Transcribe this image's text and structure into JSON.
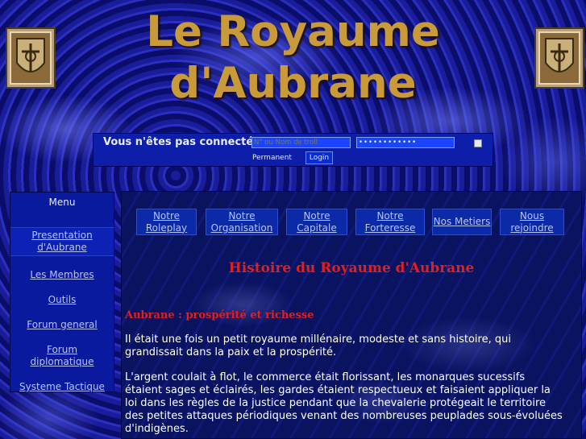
{
  "header": {
    "title_line1": "Le Royaume",
    "title_line2": "d'Aubrane",
    "logo_left": "crest-icon",
    "logo_right": "crest-icon"
  },
  "login": {
    "message": "Vous n'êtes pas connecté :",
    "username_placeholder": "N° ou Nom de troll",
    "password_value": "••••••••••••",
    "permanent_label": "Permanent",
    "login_button": "Login"
  },
  "menu": {
    "title": "Menu",
    "items": [
      {
        "label": "Presentation d'Aubrane"
      },
      {
        "label": "Les Membres"
      },
      {
        "label": "Outils"
      },
      {
        "label": "Forum general"
      },
      {
        "label": "Forum diplomatique"
      },
      {
        "label": "Systeme Tactique"
      }
    ]
  },
  "tabs": [
    {
      "label": "Notre Roleplay"
    },
    {
      "label": "Notre Organisation"
    },
    {
      "label": "Notre Capitale"
    },
    {
      "label": "Notre Forteresse"
    },
    {
      "label": "Nos Metiers"
    },
    {
      "label": "Nous rejoindre"
    }
  ],
  "content": {
    "heading": "Histoire du Royaume d'Aubrane",
    "subheading": "Aubrane : prospérité et richesse",
    "paragraph1": "Il était une fois un petit royaume millénaire, modeste et sans histoire, qui grandissait dans la paix et la prospérité.",
    "paragraph2": "L'argent coulait à flot, le commerce était florissant, les monarques sucessifs étaient sages et éclairés, les gardes étaient respectueux et faisaient appliquer la loi dans les règles de la justice pendant que la chevalerie protégeait le territoire des petites attaques périodiques venant des nombreuses peuplades sous-évoluées d'indigènes."
  },
  "colors": {
    "title_gold": "#c99a3a",
    "heading_red": "#e31e1e",
    "link_blue": "#b8c3ff"
  }
}
